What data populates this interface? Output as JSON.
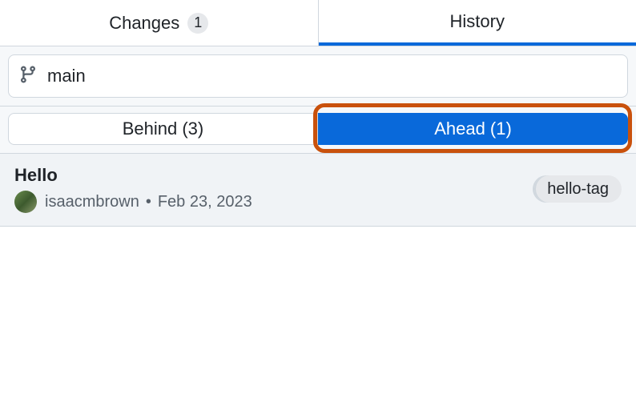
{
  "tabs": {
    "changes": {
      "label": "Changes",
      "count": "1"
    },
    "history": {
      "label": "History"
    }
  },
  "branch": {
    "name": "main"
  },
  "segments": {
    "behind": "Behind (3)",
    "ahead": "Ahead (1)"
  },
  "commit": {
    "title": "Hello",
    "author": "isaacmbrown",
    "date": "Feb 23, 2023",
    "tag": "hello-tag"
  }
}
